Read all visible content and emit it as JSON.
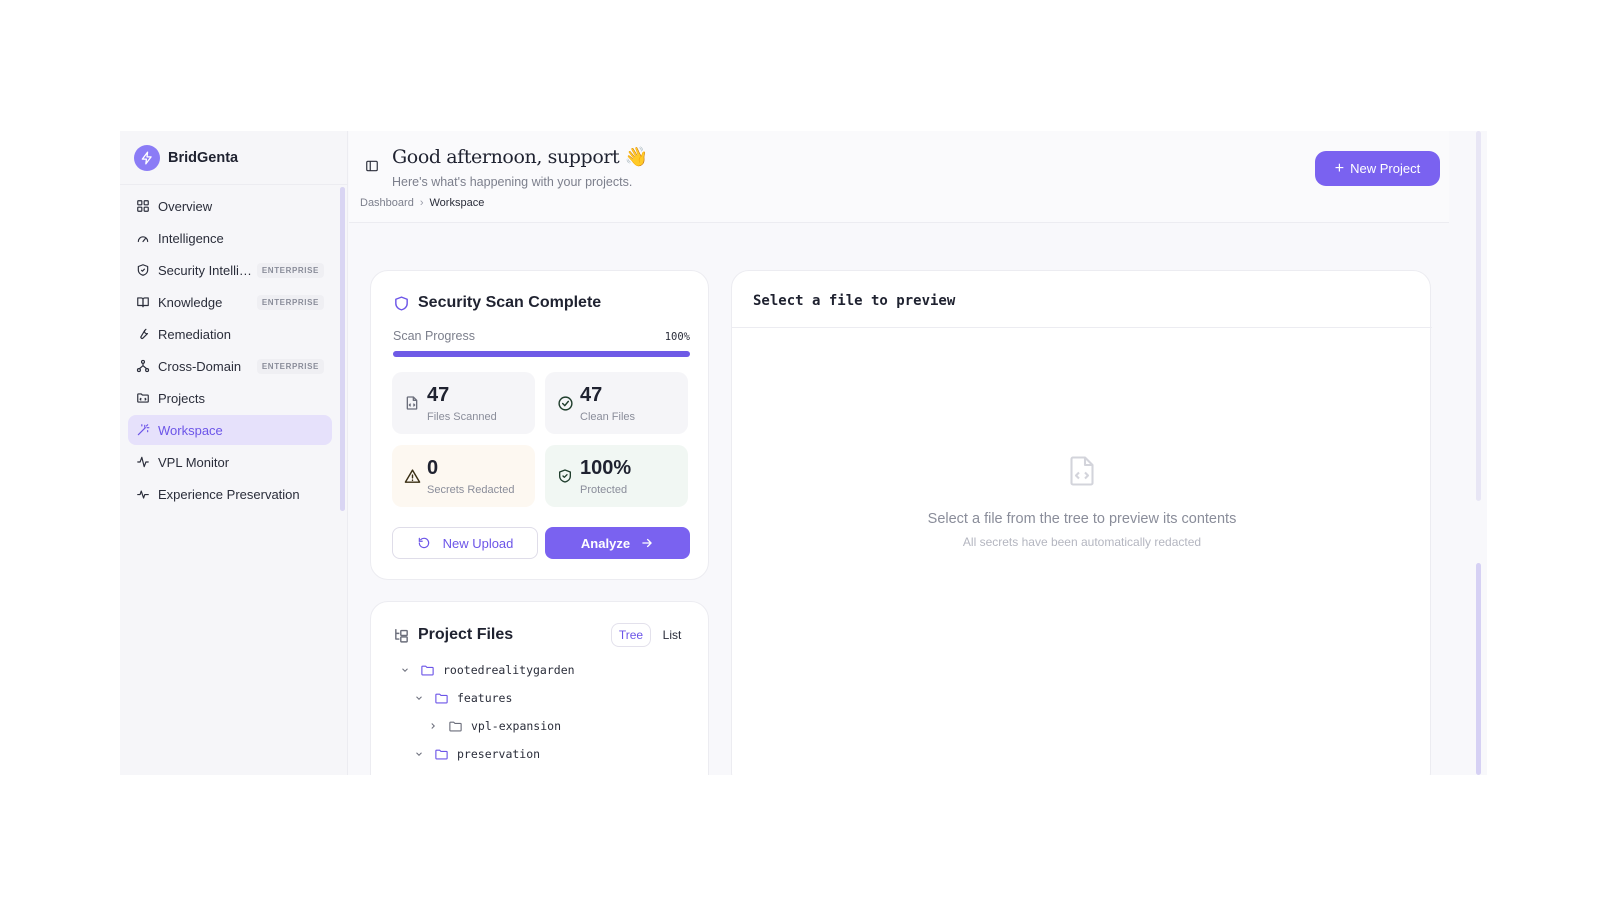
{
  "brand": {
    "name": "BridGenta",
    "icon": "bolt-icon"
  },
  "sidebar": {
    "items": [
      {
        "label": "Overview",
        "icon": "grid-icon",
        "badge": ""
      },
      {
        "label": "Intelligence",
        "icon": "gauge-icon",
        "badge": ""
      },
      {
        "label": "Security Intellig...",
        "icon": "shield-icon",
        "badge": "ENTERPRISE"
      },
      {
        "label": "Knowledge",
        "icon": "book-icon",
        "badge": "ENTERPRISE"
      },
      {
        "label": "Remediation",
        "icon": "wrench-icon",
        "badge": ""
      },
      {
        "label": "Cross-Domain",
        "icon": "network-icon",
        "badge": "ENTERPRISE"
      },
      {
        "label": "Projects",
        "icon": "folder-icon",
        "badge": ""
      },
      {
        "label": "Workspace",
        "icon": "wand-icon",
        "badge": "",
        "active": true
      },
      {
        "label": "VPL Monitor",
        "icon": "activity-icon",
        "badge": ""
      },
      {
        "label": "Experience Preservation",
        "icon": "pulse-icon",
        "badge": ""
      }
    ]
  },
  "header": {
    "greeting": "Good afternoon, support 👋",
    "subtitle": "Here's what's happening with your projects.",
    "breadcrumb": [
      "Dashboard",
      "Workspace"
    ],
    "new_project_label": "New Project"
  },
  "scan": {
    "title": "Security Scan Complete",
    "progress_label": "Scan Progress",
    "progress_value": "100%",
    "progress_fraction": 1.0,
    "stats": [
      {
        "value": "47",
        "caption": "Files Scanned",
        "icon": "file-code-icon"
      },
      {
        "value": "47",
        "caption": "Clean Files",
        "icon": "check-circle-icon"
      },
      {
        "value": "0",
        "caption": "Secrets Redacted",
        "icon": "warning-icon"
      },
      {
        "value": "100%",
        "caption": "Protected",
        "icon": "shield-check-icon"
      }
    ],
    "upload_label": "New Upload",
    "analyze_label": "Analyze"
  },
  "files": {
    "title": "Project Files",
    "view_tree": "Tree",
    "view_list": "List",
    "tree": [
      {
        "name": "rootedrealitygarden",
        "expanded": true
      },
      {
        "name": "features",
        "expanded": true
      },
      {
        "name": "vpl-expansion",
        "expanded": false
      },
      {
        "name": "preservation",
        "expanded": true
      }
    ]
  },
  "preview": {
    "title": "Select a file to preview",
    "message": "Select a file from the tree to preview its contents",
    "submessage": "All secrets have been automatically redacted"
  },
  "colors": {
    "accent": "#7a62f0",
    "active_bg": "#e6e1fb"
  }
}
